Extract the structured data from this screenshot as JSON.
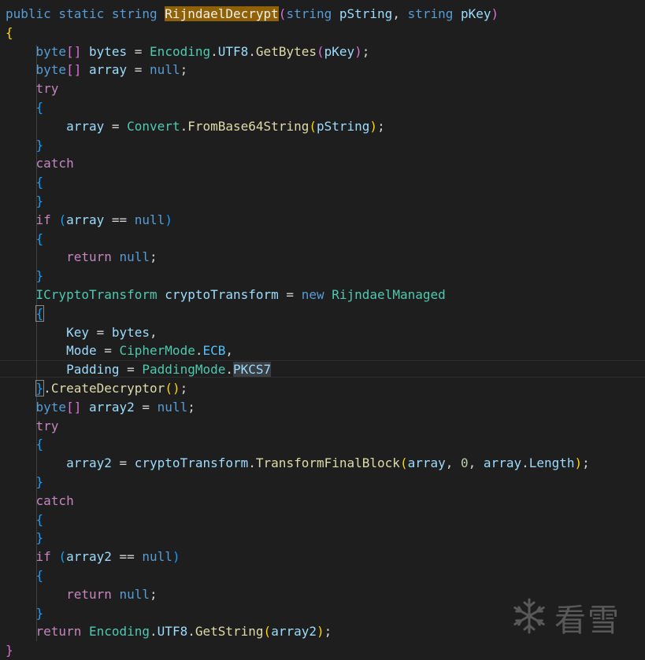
{
  "editor": {
    "lines": [
      [
        [
          "public static string ",
          "kw"
        ],
        [
          "RijndaelDecrypt",
          "sel"
        ],
        [
          "(",
          "b2"
        ],
        [
          "string ",
          "kw"
        ],
        [
          "pString",
          "var"
        ],
        [
          ", ",
          "plain"
        ],
        [
          "string ",
          "kw"
        ],
        [
          "pKey",
          "var"
        ],
        [
          ")",
          "b2"
        ]
      ],
      [
        [
          "{",
          "b1"
        ]
      ],
      [
        [
          "    ",
          "plain"
        ],
        [
          "byte",
          "kw"
        ],
        [
          "[]",
          "b2"
        ],
        [
          " ",
          "plain"
        ],
        [
          "bytes",
          "var"
        ],
        [
          " = ",
          "plain"
        ],
        [
          "Encoding",
          "type"
        ],
        [
          ".",
          "plain"
        ],
        [
          "UTF8",
          "var"
        ],
        [
          ".",
          "plain"
        ],
        [
          "GetBytes",
          "fn"
        ],
        [
          "(",
          "b2"
        ],
        [
          "pKey",
          "var"
        ],
        [
          ")",
          "b2"
        ],
        [
          ";",
          "plain"
        ]
      ],
      [
        [
          "    ",
          "plain"
        ],
        [
          "byte",
          "kw"
        ],
        [
          "[]",
          "b2"
        ],
        [
          " ",
          "plain"
        ],
        [
          "array",
          "var"
        ],
        [
          " = ",
          "plain"
        ],
        [
          "null",
          "kw"
        ],
        [
          ";",
          "plain"
        ]
      ],
      [
        [
          "    ",
          "plain"
        ],
        [
          "try",
          "ctl"
        ]
      ],
      [
        [
          "    ",
          "plain"
        ],
        [
          "{",
          "b3"
        ]
      ],
      [
        [
          "        ",
          "plain"
        ],
        [
          "array",
          "var"
        ],
        [
          " = ",
          "plain"
        ],
        [
          "Convert",
          "type"
        ],
        [
          ".",
          "plain"
        ],
        [
          "FromBase64String",
          "fn"
        ],
        [
          "(",
          "b1"
        ],
        [
          "pString",
          "var"
        ],
        [
          ")",
          "b1"
        ],
        [
          ";",
          "plain"
        ]
      ],
      [
        [
          "    ",
          "plain"
        ],
        [
          "}",
          "b3"
        ]
      ],
      [
        [
          "    ",
          "plain"
        ],
        [
          "catch",
          "ctl"
        ]
      ],
      [
        [
          "    ",
          "plain"
        ],
        [
          "{",
          "b3"
        ]
      ],
      [
        [
          "    ",
          "plain"
        ],
        [
          "}",
          "b3"
        ]
      ],
      [
        [
          "    ",
          "plain"
        ],
        [
          "if",
          "ctl"
        ],
        [
          " ",
          "plain"
        ],
        [
          "(",
          "b3"
        ],
        [
          "array",
          "var"
        ],
        [
          " == ",
          "plain"
        ],
        [
          "null",
          "kw"
        ],
        [
          ")",
          "b3"
        ]
      ],
      [
        [
          "    ",
          "plain"
        ],
        [
          "{",
          "b3"
        ]
      ],
      [
        [
          "        ",
          "plain"
        ],
        [
          "return",
          "ctl"
        ],
        [
          " ",
          "plain"
        ],
        [
          "null",
          "kw"
        ],
        [
          ";",
          "plain"
        ]
      ],
      [
        [
          "    ",
          "plain"
        ],
        [
          "}",
          "b3"
        ]
      ],
      [
        [
          "    ",
          "plain"
        ],
        [
          "ICryptoTransform",
          "type"
        ],
        [
          " ",
          "plain"
        ],
        [
          "cryptoTransform",
          "var"
        ],
        [
          " = ",
          "plain"
        ],
        [
          "new",
          "kw"
        ],
        [
          " ",
          "plain"
        ],
        [
          "RijndaelManaged",
          "type"
        ]
      ],
      [
        [
          "    ",
          "plain"
        ],
        [
          "{",
          "brace"
        ]
      ],
      [
        [
          "        ",
          "plain"
        ],
        [
          "Key",
          "var"
        ],
        [
          " = ",
          "plain"
        ],
        [
          "bytes",
          "var"
        ],
        [
          ",",
          "plain"
        ]
      ],
      [
        [
          "        ",
          "plain"
        ],
        [
          "Mode",
          "var"
        ],
        [
          " = ",
          "plain"
        ],
        [
          "CipherMode",
          "type"
        ],
        [
          ".",
          "plain"
        ],
        [
          "ECB",
          "enum"
        ],
        [
          ",",
          "plain"
        ]
      ],
      [
        [
          "        ",
          "plain"
        ],
        [
          "Padding",
          "var"
        ],
        [
          " = ",
          "plain"
        ],
        [
          "PaddingMode",
          "type"
        ],
        [
          ".",
          "plain"
        ],
        [
          "PKCS7",
          "word"
        ]
      ],
      [
        [
          "    ",
          "plain"
        ],
        [
          "}",
          "brace"
        ],
        [
          ".",
          "plain"
        ],
        [
          "CreateDecryptor",
          "fn"
        ],
        [
          "(",
          "b1"
        ],
        [
          ")",
          "b1"
        ],
        [
          ";",
          "plain"
        ]
      ],
      [
        [
          "    ",
          "plain"
        ],
        [
          "byte",
          "kw"
        ],
        [
          "[]",
          "b2"
        ],
        [
          " ",
          "plain"
        ],
        [
          "array2",
          "var"
        ],
        [
          " = ",
          "plain"
        ],
        [
          "null",
          "kw"
        ],
        [
          ";",
          "plain"
        ]
      ],
      [
        [
          "    ",
          "plain"
        ],
        [
          "try",
          "ctl"
        ]
      ],
      [
        [
          "    ",
          "plain"
        ],
        [
          "{",
          "b3"
        ]
      ],
      [
        [
          "        ",
          "plain"
        ],
        [
          "array2",
          "var"
        ],
        [
          " = ",
          "plain"
        ],
        [
          "cryptoTransform",
          "var"
        ],
        [
          ".",
          "plain"
        ],
        [
          "TransformFinalBlock",
          "fn"
        ],
        [
          "(",
          "b1"
        ],
        [
          "array",
          "var"
        ],
        [
          ", ",
          "plain"
        ],
        [
          "0",
          "num"
        ],
        [
          ", ",
          "plain"
        ],
        [
          "array",
          "var"
        ],
        [
          ".",
          "plain"
        ],
        [
          "Length",
          "var"
        ],
        [
          ")",
          "b1"
        ],
        [
          ";",
          "plain"
        ]
      ],
      [
        [
          "    ",
          "plain"
        ],
        [
          "}",
          "b3"
        ]
      ],
      [
        [
          "    ",
          "plain"
        ],
        [
          "catch",
          "ctl"
        ]
      ],
      [
        [
          "    ",
          "plain"
        ],
        [
          "{",
          "b3"
        ]
      ],
      [
        [
          "    ",
          "plain"
        ],
        [
          "}",
          "b3"
        ]
      ],
      [
        [
          "    ",
          "plain"
        ],
        [
          "if",
          "ctl"
        ],
        [
          " ",
          "plain"
        ],
        [
          "(",
          "b3"
        ],
        [
          "array2",
          "var"
        ],
        [
          " == ",
          "plain"
        ],
        [
          "null",
          "kw"
        ],
        [
          ")",
          "b3"
        ]
      ],
      [
        [
          "    ",
          "plain"
        ],
        [
          "{",
          "b3"
        ]
      ],
      [
        [
          "        ",
          "plain"
        ],
        [
          "return",
          "ctl"
        ],
        [
          " ",
          "plain"
        ],
        [
          "null",
          "kw"
        ],
        [
          ";",
          "plain"
        ]
      ],
      [
        [
          "    ",
          "plain"
        ],
        [
          "}",
          "b3"
        ]
      ],
      [
        [
          "    ",
          "plain"
        ],
        [
          "return",
          "ctl"
        ],
        [
          " ",
          "plain"
        ],
        [
          "Encoding",
          "type"
        ],
        [
          ".",
          "plain"
        ],
        [
          "UTF8",
          "var"
        ],
        [
          ".",
          "plain"
        ],
        [
          "GetString",
          "fn"
        ],
        [
          "(",
          "b1"
        ],
        [
          "array2",
          "var"
        ],
        [
          ")",
          "b1"
        ],
        [
          ";",
          "plain"
        ]
      ],
      [
        [
          "}",
          "b2"
        ]
      ]
    ]
  },
  "watermark": {
    "text": "看雪",
    "icon": "snowflake-icon"
  },
  "colors": {
    "background": "#1e1e1e",
    "keyword": "#569cd6",
    "control": "#c586c0",
    "type": "#4ec9b0",
    "function": "#dcdcaa",
    "variable": "#9cdcfe",
    "selection_highlight": "#8f6100"
  }
}
